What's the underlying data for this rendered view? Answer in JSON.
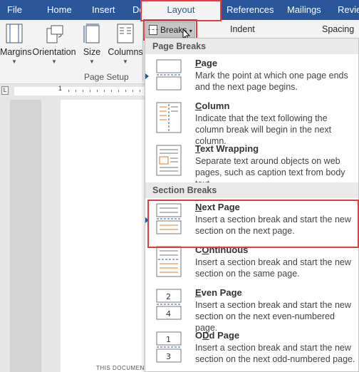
{
  "tabs": [
    {
      "label": "File"
    },
    {
      "label": "Home"
    },
    {
      "label": "Insert"
    },
    {
      "label": "Design"
    },
    {
      "label": "Layout"
    },
    {
      "label": "References"
    },
    {
      "label": "Mailings"
    },
    {
      "label": "Revie"
    }
  ],
  "ribbon": {
    "margins": "Margins",
    "orientation": "Orientation",
    "size": "Size",
    "columns": "Columns",
    "breaks": "Breaks",
    "indent": "Indent",
    "spacing": "Spacing",
    "group_label": "Page Setup"
  },
  "ruler": {
    "number": "1"
  },
  "document": {
    "snippet": "THIS DOCUMENT WILL ALWAYS CHANGE THE LINE"
  },
  "breaks_menu": {
    "page_breaks_header": "Page Breaks",
    "section_breaks_header": "Section Breaks",
    "items": [
      {
        "title": "Page",
        "key": "P",
        "rest": "age",
        "desc": "Mark the point at which one page ends and the next page begins."
      },
      {
        "title": "Column",
        "key": "C",
        "rest": "olumn",
        "desc": "Indicate that the text following the column break will begin in the next column."
      },
      {
        "title": "Text Wrapping",
        "key": "T",
        "rest": "ext Wrapping",
        "desc": "Separate text around objects on web pages, such as caption text from body text."
      },
      {
        "title": "Next Page",
        "key": "N",
        "rest": "ext Page",
        "desc": "Insert a section break and start the new section on the next page."
      },
      {
        "title": "Continuous",
        "key": "O",
        "rest": "",
        "desc": "Insert a section break and start the new section on the same page."
      },
      {
        "title": "Even Page",
        "key": "E",
        "rest": "ven Page",
        "desc": "Insert a section break and start the new section on the next even-numbered page."
      },
      {
        "title": "Odd Page",
        "key": "D",
        "rest": "",
        "desc": "Insert a section break and start the new section on the next odd-numbered page."
      }
    ],
    "icon_numbers": {
      "even_top": "2",
      "even_bottom": "4",
      "odd_top": "1",
      "odd_bottom": "3"
    }
  },
  "colors": {
    "ribbon_blue": "#2b579a",
    "highlight_red": "#e03c43"
  },
  "icons": [
    "margins-icon",
    "orientation-icon",
    "size-icon",
    "columns-icon",
    "breaks-icon",
    "page-break-icon",
    "column-break-icon",
    "text-wrapping-icon",
    "next-page-icon",
    "continuous-icon",
    "even-page-icon",
    "odd-page-icon",
    "mouse-cursor-icon"
  ]
}
